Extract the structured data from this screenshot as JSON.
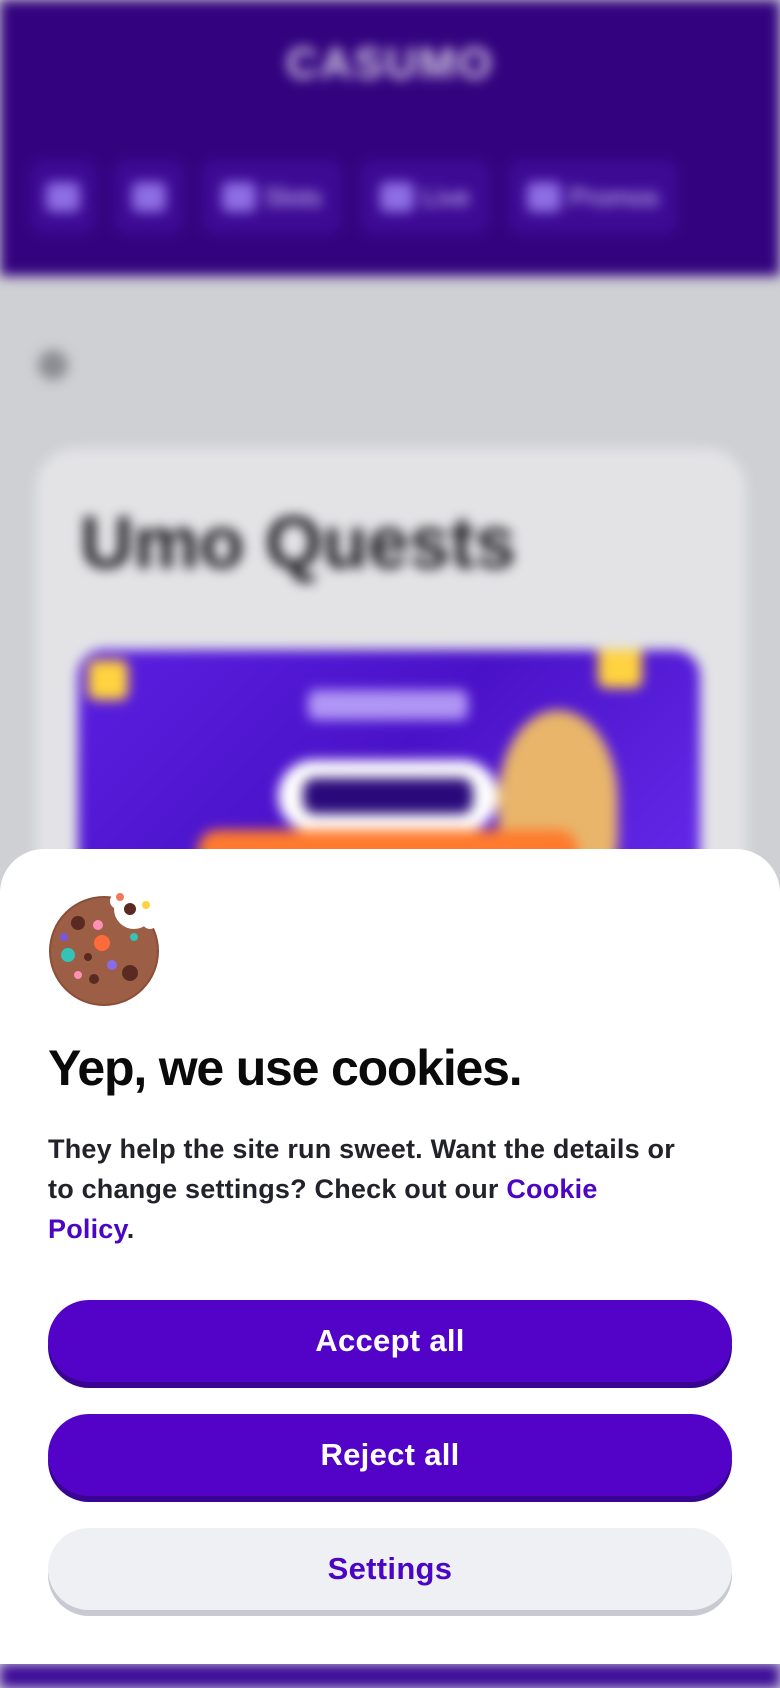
{
  "background_page": {
    "logo": "CASUMO",
    "nav": [
      {
        "label": "",
        "icon": "search-icon"
      },
      {
        "label": "",
        "icon": "home-icon"
      },
      {
        "label": "Slots",
        "icon": "slot-machine-icon"
      },
      {
        "label": "Live",
        "icon": "live-camera-icon"
      },
      {
        "label": "Promos",
        "icon": "gift-icon"
      }
    ],
    "card_title": "Umo Quests",
    "banner_text": "UNLOCK"
  },
  "cookie_banner": {
    "icon": "cookie-icon",
    "title": "Yep, we use cookies.",
    "body_text": "They help the site run sweet. Want the details or to change settings? Check out our ",
    "policy_link": "Cookie Policy",
    "body_end": ".",
    "accept_label": "Accept all",
    "reject_label": "Reject all",
    "settings_label": "Settings"
  },
  "colors": {
    "brand_purple": "#5303c8",
    "header_purple": "#33037f",
    "link_purple": "#4d05c4",
    "secondary_button_bg": "#eff0f3"
  }
}
